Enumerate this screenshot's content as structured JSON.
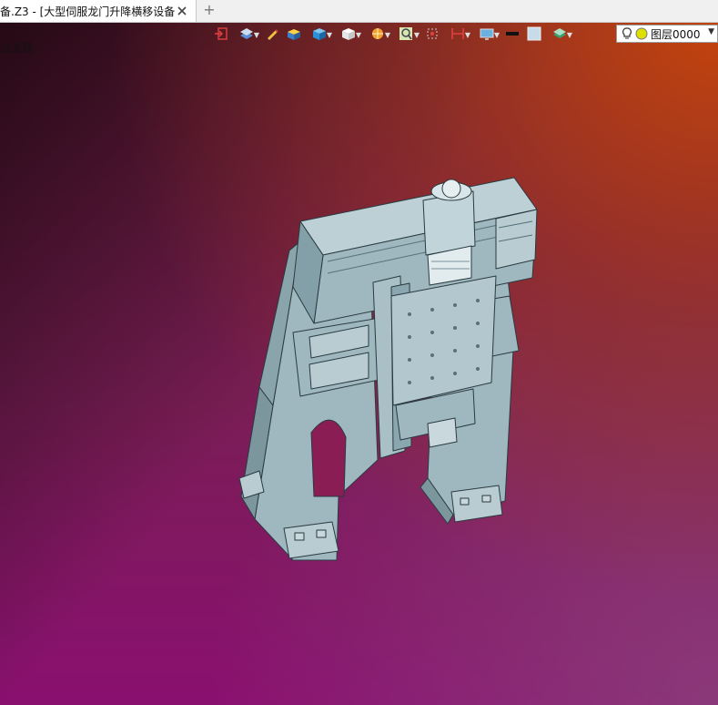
{
  "tab": {
    "title": "备.Z3 - [大型伺服龙门升降横移设备]",
    "close_icon": "close-icon",
    "new_tab_symbol": "+"
  },
  "viewport": {
    "hint_text": "过滤器:",
    "background_colors": [
      "#1a0a0c",
      "#8a1070",
      "#c24a0c"
    ]
  },
  "toolbar": {
    "icons": [
      "exit-sketch-icon",
      "display-mode-icon",
      "pencil-icon",
      "shaded-box-icon",
      "solid-box-icon",
      "wire-box-icon",
      "render-icon",
      "zoom-view-icon",
      "point-snap-icon",
      "dimension-icon",
      "monitor-icon",
      "line-color-icon",
      "fill-color-icon",
      "layer-stack-icon"
    ],
    "layer_label": "图层0000",
    "layer_icons": [
      "bulb-icon",
      "layer-color-icon"
    ]
  },
  "model": {
    "description_icon": "gantry-model",
    "color": "#a7c0c8"
  }
}
